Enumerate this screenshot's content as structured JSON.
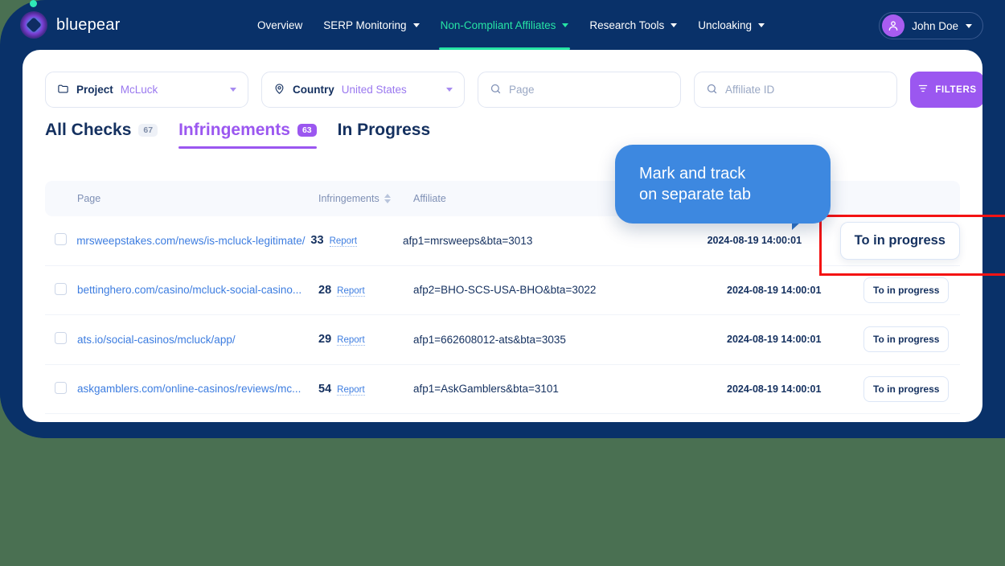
{
  "brand": {
    "name": "bluepear",
    "logo_icon": "bluepear-logo-icon",
    "dot_icon": "accent-dot-icon"
  },
  "nav": {
    "items": [
      {
        "label": "Overview",
        "has_caret": false,
        "active": false
      },
      {
        "label": "SERP Monitoring",
        "has_caret": true,
        "active": false
      },
      {
        "label": "Non-Compliant Affiliates",
        "has_caret": true,
        "active": true
      },
      {
        "label": "Research Tools",
        "has_caret": true,
        "active": false
      },
      {
        "label": "Uncloaking",
        "has_caret": true,
        "active": false
      }
    ],
    "active_color": "#26e4a5"
  },
  "user": {
    "name": "John Doe",
    "avatar_icon": "user-avatar-icon",
    "caret_icon": "chevron-down-icon"
  },
  "filters": {
    "project": {
      "icon": "folder-icon",
      "label": "Project",
      "value": "McLuck"
    },
    "country": {
      "icon": "location-pin-icon",
      "label": "Country",
      "value": "United States"
    },
    "page_search": {
      "icon": "search-icon",
      "placeholder": "Page",
      "value": ""
    },
    "affiliate_search": {
      "icon": "search-icon",
      "placeholder": "Affiliate ID",
      "value": ""
    },
    "filters_button": {
      "label": "FILTERS",
      "icon": "filter-icon",
      "color": "#9b57f0"
    }
  },
  "tabs": [
    {
      "label": "All Checks",
      "badge": "67",
      "active": false
    },
    {
      "label": "Infringements",
      "badge": "63",
      "active": true
    },
    {
      "label": "In Progress",
      "badge": "",
      "active": false
    }
  ],
  "table": {
    "headers": {
      "page": "Page",
      "infringements": "Infringements",
      "affiliate": "Affiliate",
      "date": "",
      "action": ""
    },
    "sort_icon": "sort-arrows-icon",
    "rows": [
      {
        "page": "mrsweepstakes.com/news/is-mcluck-legitimate/",
        "infringements": "33",
        "report": "Report",
        "affiliate": "afp1=mrsweeps&bta=3013",
        "date": "2024-08-19 14:00:01",
        "action": "To in progress"
      },
      {
        "page": "bettinghero.com/casino/mcluck-social-casino...",
        "infringements": "28",
        "report": "Report",
        "affiliate": "afp2=BHO-SCS-USA-BHO&bta=3022",
        "date": "2024-08-19 14:00:01",
        "action": "To in progress"
      },
      {
        "page": "ats.io/social-casinos/mcluck/app/",
        "infringements": "29",
        "report": "Report",
        "affiliate": "afp1=662608012-ats&bta=3035",
        "date": "2024-08-19 14:00:01",
        "action": "To in progress"
      },
      {
        "page": "askgamblers.com/online-casinos/reviews/mc...",
        "infringements": "54",
        "report": "Report",
        "affiliate": "afp1=AskGamblers&bta=3101",
        "date": "2024-08-19 14:00:01",
        "action": "To in progress"
      }
    ]
  },
  "annotation": {
    "callout_text": "Mark and track\non separate tab",
    "callout_color": "#3d88e0",
    "highlight_color": "#f41313"
  },
  "theme": {
    "panel_navy": "#093169",
    "page_background": "#4a7052",
    "accent_purple": "#9b57f0",
    "link_blue": "#3d7de0"
  }
}
